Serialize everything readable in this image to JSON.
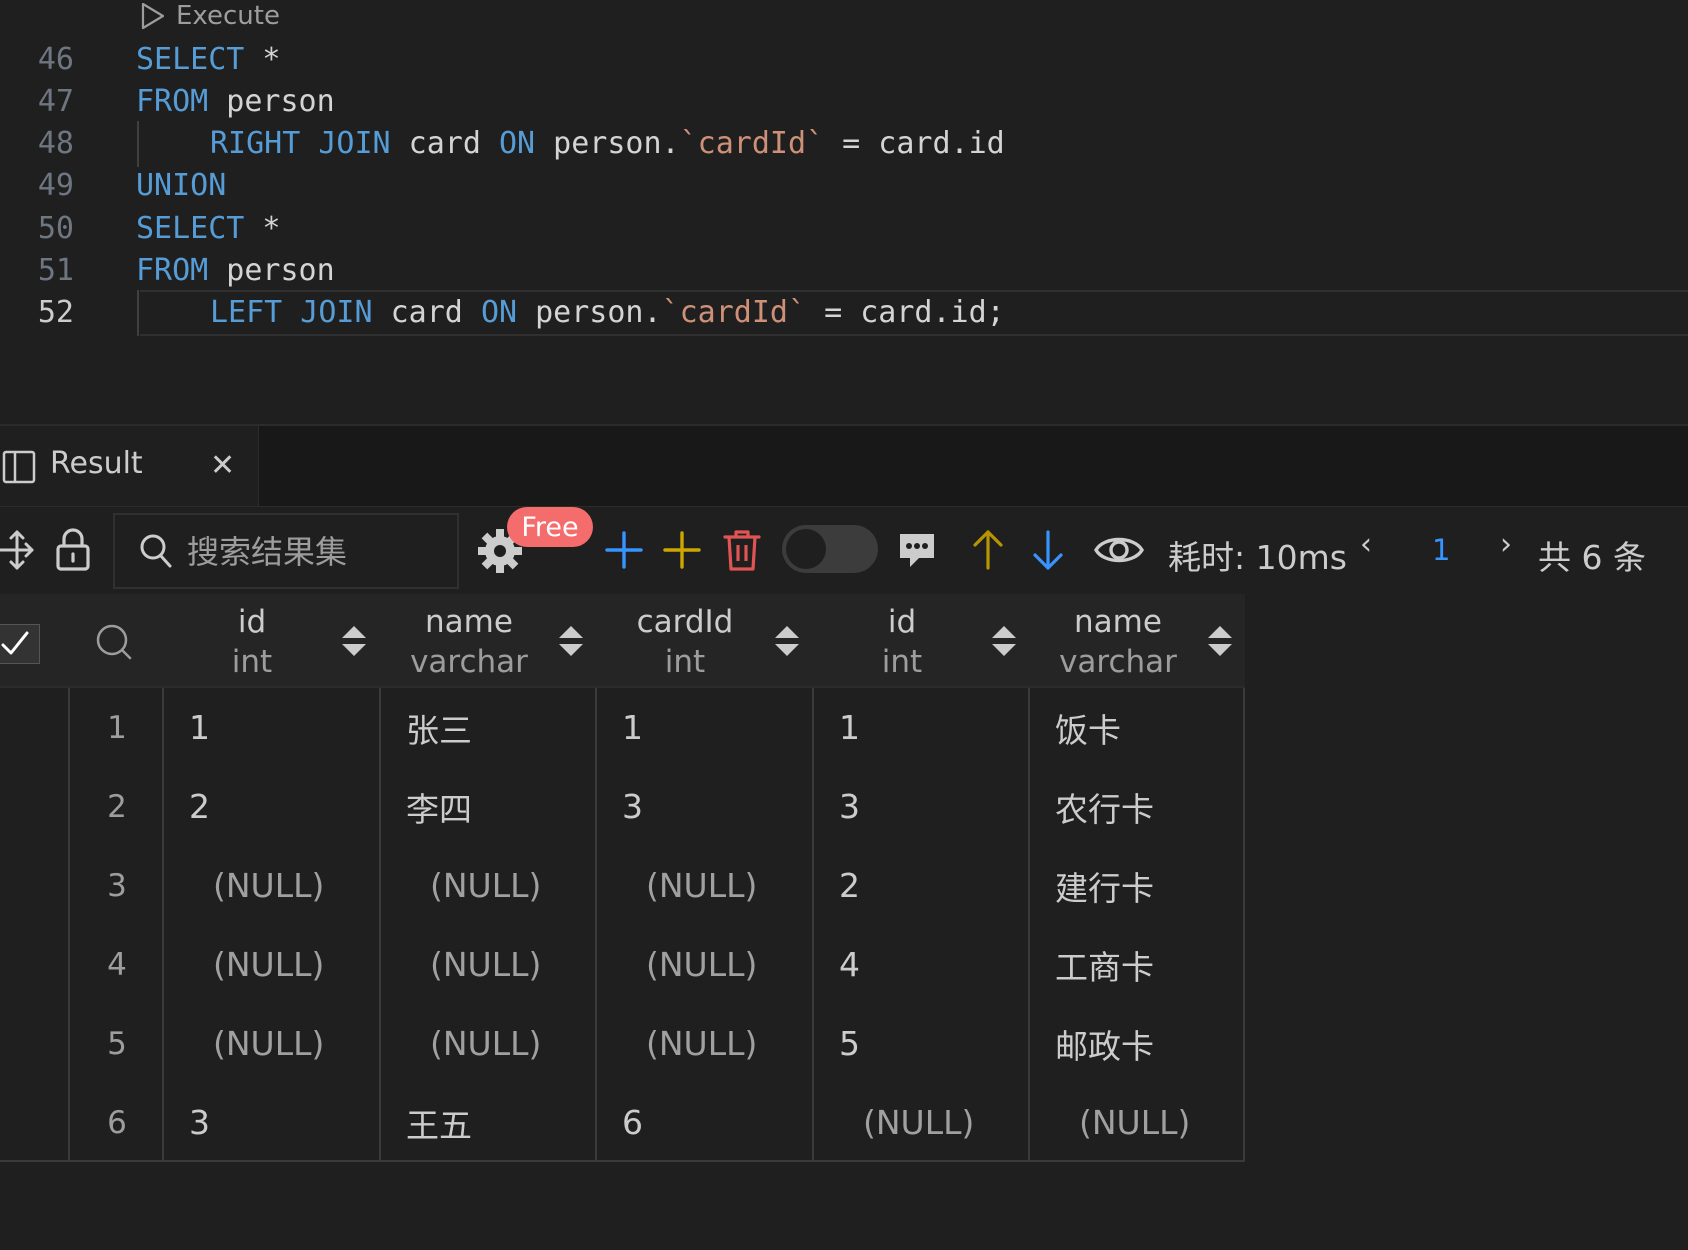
{
  "editor": {
    "codelens_label": "Execute",
    "lines": [
      {
        "num": "46",
        "tokens": [
          {
            "t": "SELECT",
            "c": "kw"
          },
          {
            "t": " *",
            "c": "id"
          }
        ]
      },
      {
        "num": "47",
        "tokens": [
          {
            "t": "FROM",
            "c": "kw"
          },
          {
            "t": " person",
            "c": "id"
          }
        ]
      },
      {
        "num": "48",
        "indent": true,
        "tokens": [
          {
            "t": "RIGHT JOIN",
            "c": "kw"
          },
          {
            "t": " card ",
            "c": "id"
          },
          {
            "t": "ON",
            "c": "kw"
          },
          {
            "t": " person.",
            "c": "id"
          },
          {
            "t": "`cardId`",
            "c": "str"
          },
          {
            "t": " = card.id",
            "c": "id"
          }
        ]
      },
      {
        "num": "49",
        "tokens": [
          {
            "t": "UNION",
            "c": "kw"
          }
        ]
      },
      {
        "num": "50",
        "tokens": [
          {
            "t": "SELECT",
            "c": "kw"
          },
          {
            "t": " *",
            "c": "id"
          }
        ]
      },
      {
        "num": "51",
        "tokens": [
          {
            "t": "FROM",
            "c": "kw"
          },
          {
            "t": " person",
            "c": "id"
          }
        ]
      },
      {
        "num": "52",
        "indent": true,
        "current": true,
        "tokens": [
          {
            "t": "LEFT JOIN",
            "c": "kw"
          },
          {
            "t": " card ",
            "c": "id"
          },
          {
            "t": "ON",
            "c": "kw"
          },
          {
            "t": " person.",
            "c": "id"
          },
          {
            "t": "`cardId`",
            "c": "str"
          },
          {
            "t": " = card.id;",
            "c": "id"
          }
        ]
      }
    ]
  },
  "result_tab": {
    "label": "Result",
    "close_glyph": "✕"
  },
  "toolbar": {
    "search_placeholder": "搜索结果集",
    "free_badge": "Free",
    "elapsed": "耗时: 10ms",
    "pager_prev": "‹",
    "pager_page": "1",
    "pager_next": "›",
    "total": "共 6 条",
    "icons": [
      "move-icon",
      "lock-icon",
      "search-icon",
      "settings-icon",
      "add-row-icon",
      "insert-row-icon",
      "delete-icon",
      "toggle",
      "comment-icon",
      "arrow-up-icon",
      "arrow-down-icon",
      "eye-icon"
    ],
    "colors": {
      "add": "#3794ff",
      "insert": "#cca700",
      "delete": "#e05454",
      "up": "#b89500",
      "down": "#3794ff"
    }
  },
  "grid": {
    "columns": [
      {
        "name": "id",
        "type": "int"
      },
      {
        "name": "name",
        "type": "varchar"
      },
      {
        "name": "cardId",
        "type": "int"
      },
      {
        "name": "id",
        "type": "int"
      },
      {
        "name": "name",
        "type": "varchar"
      }
    ],
    "rows": [
      {
        "n": "1",
        "cells": [
          "1",
          "张三",
          "1",
          "1",
          "饭卡"
        ]
      },
      {
        "n": "2",
        "cells": [
          "2",
          "李四",
          "3",
          "3",
          "农行卡"
        ]
      },
      {
        "n": "3",
        "cells": [
          "(NULL)",
          "(NULL)",
          "(NULL)",
          "2",
          "建行卡"
        ]
      },
      {
        "n": "4",
        "cells": [
          "(NULL)",
          "(NULL)",
          "(NULL)",
          "4",
          "工商卡"
        ]
      },
      {
        "n": "5",
        "cells": [
          "(NULL)",
          "(NULL)",
          "(NULL)",
          "5",
          "邮政卡"
        ]
      },
      {
        "n": "6",
        "cells": [
          "3",
          "王五",
          "6",
          "(NULL)",
          "(NULL)"
        ]
      }
    ],
    "null_text": "(NULL)"
  }
}
